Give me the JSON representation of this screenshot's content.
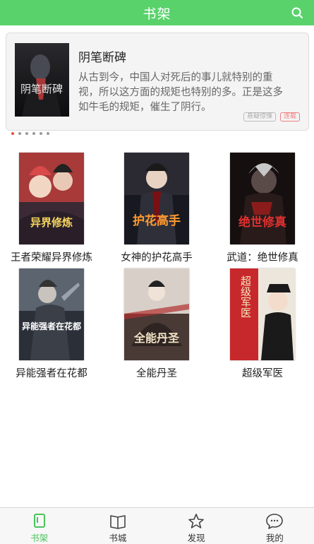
{
  "header": {
    "title": "书架"
  },
  "featured": {
    "title": "阴笔断碑",
    "description": "从古到今，中国人对死后的事儿就特别的重视，所以这方面的规矩也特别的多。正是这多如牛毛的规矩，催生了阴行。",
    "cover_text": "阴笔断碑",
    "tags": [
      "悬疑惊悚",
      "连载"
    ]
  },
  "carousel": {
    "count": 6,
    "active": 0
  },
  "books": [
    {
      "title": "王者荣耀异界修炼",
      "cover_text": "异界修炼",
      "colors": {
        "top": "#a83a3a",
        "bottom": "#3b2a35",
        "accent": "#f4d35e"
      }
    },
    {
      "title": "女神的护花高手",
      "cover_text": "护花高手",
      "colors": {
        "top": "#2b2a33",
        "bottom": "#181820",
        "accent": "#ff9b2f"
      }
    },
    {
      "title": "武道：绝世修真",
      "cover_text": "绝世修真",
      "colors": {
        "top": "#2a1b1b",
        "bottom": "#160f10",
        "accent": "#e0302e"
      }
    },
    {
      "title": "异能强者在花都",
      "cover_text": "异能强者在花都",
      "colors": {
        "top": "#5c6470",
        "bottom": "#2b3038",
        "accent": "#ffffff"
      }
    },
    {
      "title": "全能丹圣",
      "cover_text": "全能丹圣",
      "colors": {
        "top": "#d8d0c8",
        "bottom": "#4a3a36",
        "accent": "#f1e4c4"
      }
    },
    {
      "title": "超级军医",
      "cover_text": "超级军医",
      "colors": {
        "top": "#c7282c",
        "bottom": "#1a1a1a",
        "accent": "#d8a03a"
      }
    }
  ],
  "bottom_nav": [
    {
      "label": "书架",
      "icon": "bookshelf-icon",
      "active": true
    },
    {
      "label": "书城",
      "icon": "open-book-icon",
      "active": false
    },
    {
      "label": "发现",
      "icon": "star-icon",
      "active": false
    },
    {
      "label": "我的",
      "icon": "chat-bubble-icon",
      "active": false
    }
  ],
  "colors": {
    "brand": "#5ad26c",
    "active_tab": "#4cc25c",
    "indicator": "#e74c3c"
  }
}
